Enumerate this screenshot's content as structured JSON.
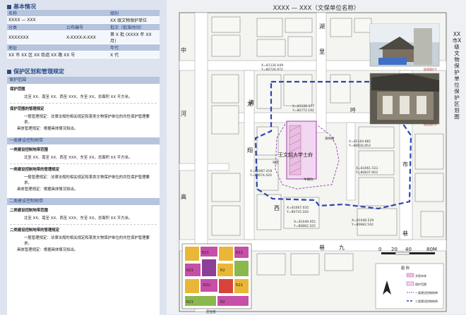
{
  "left": {
    "basic_title": "基本情况",
    "basic": [
      {
        "labels": [
          "名称",
          "",
          "级别"
        ],
        "values": [
          "XXXX — XXX",
          "",
          "XX 级文物保护单位"
        ]
      },
      {
        "labels": [
          "分类",
          "公布编号",
          "批次（批准时间）"
        ],
        "values": [
          "XXXXXXX",
          "X-XXXX-X-XXX",
          "第 X 批 (XXXX 年 XX 月)"
        ]
      },
      {
        "labels": [
          "地址",
          "",
          "年代"
        ],
        "values": [
          "XX 市 XX 区 XX 街道 XX 路 XX 号",
          "",
          "X 代"
        ]
      }
    ],
    "protect_title": "保护区划和管理规定",
    "protect_header": "保护范围",
    "s1_head": "保护范围",
    "s1_text": "北至 XX、南至 XX、西至 XXX、东至 XX，总面积 XX 平方米。",
    "s2_head": "保护范围的管理规定",
    "s2_text": "一般管理规定：法律法规的相关规定和某类文物保护单位的共性保护管理要求。",
    "s2_text_b": "具体管理规定：根据具体情况拟出。",
    "band1_header": "一类建设控制地带",
    "s3_head": "一类建设控制地带范围",
    "s3_text": "北至 XX、南至 XX、西至 XXX、东至 XX，总面积 XX 平方米。",
    "s4_head": "一类建设控制地带的管理规定",
    "s4_text": "一般管理规定：法律法规的相关规定和某类文物保护单位的共性保护管理要求。",
    "s4_text_b": "具体管理规定：根据具体情况拟出。",
    "band2_header": "二类建设控制地带",
    "s5_head": "二类建设控制地带范围",
    "s5_text": "北至 XX、南至 XX、西至 XXX、东至 XX，总面积 XX 平方米。",
    "s6_head": "二类建设控制地带的管理规定",
    "s6_text": "一般管理规定：法律法规的相关规定和某类文物保护单位的共性保护管理要求。",
    "s6_text_b": "具体管理规定：根据具体情况拟出。"
  },
  "map": {
    "title": "XXXX — XXX（文保单位名称）",
    "vertical_title": "XX市X级文物保护单位保护区划图",
    "streets": [
      "清",
      "吟",
      "巷",
      "中",
      "河",
      "高",
      "塘",
      "龙",
      "翔",
      "街",
      "湖",
      "里",
      "厅",
      "巷",
      "巷",
      "市",
      "山",
      "西",
      "双",
      "巷",
      "九",
      "河",
      "南"
    ],
    "site_label": "王文韶大学士府",
    "small_labels": [
      "清将楼",
      "祠堂",
      "牛棚坑"
    ],
    "coords": [
      "X=81126.649",
      "Y=80726.972",
      "X=81126.177",
      "Y=80772.192",
      "X=81164.881",
      "Y=80656.853",
      "X=81061.523",
      "Y=80837.903",
      "X=81087.418",
      "Y=80674.420",
      "X=81067.035",
      "Y=80725.183",
      "X=81049.951",
      "Y=80862.325",
      "X=81048.529",
      "Y=80882.542"
    ],
    "photo1_caption": "现状照片1",
    "photo2_caption": "现状照片2",
    "scale_labels": [
      "0",
      "20",
      "40",
      "80M"
    ],
    "legend_title": "图 例",
    "legend_items": [
      "文保本体",
      "保护范围",
      "一类建设控制地带",
      "二类建设控制地带"
    ],
    "inset_caption": "区位图",
    "inset_labels": [
      "R21",
      "R22",
      "R21",
      "R2",
      "R22",
      "R21",
      "R21",
      "R2"
    ]
  }
}
